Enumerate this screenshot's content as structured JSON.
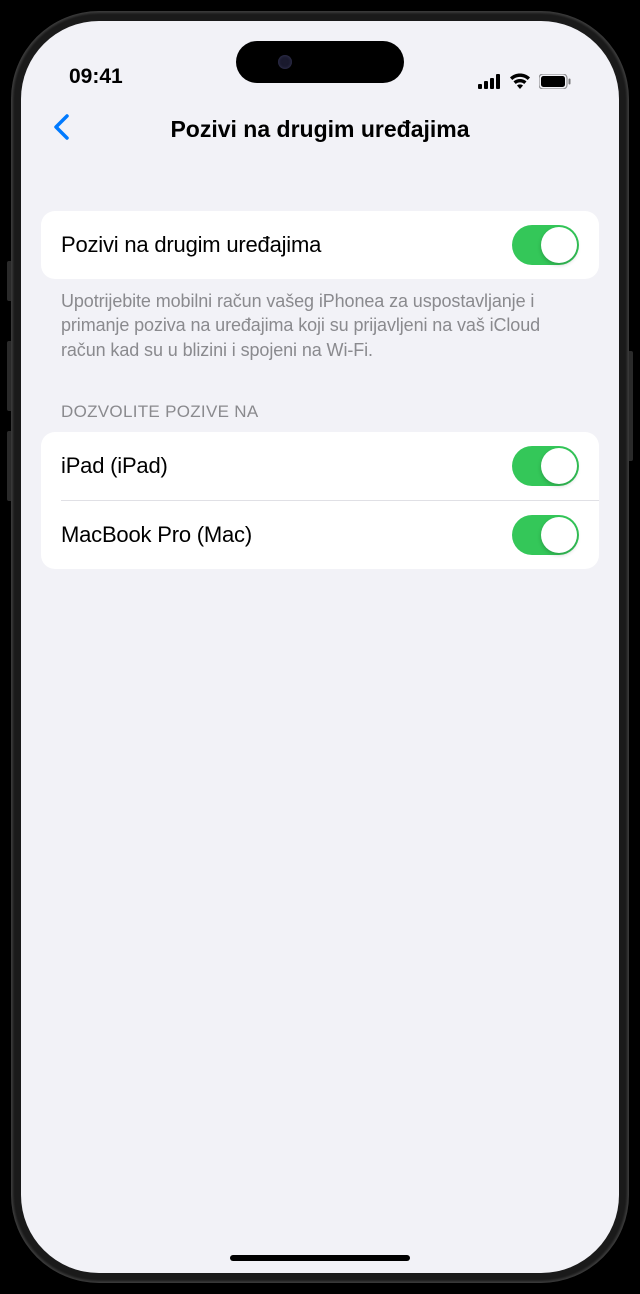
{
  "status": {
    "time": "09:41"
  },
  "nav": {
    "title": "Pozivi na drugim uređajima"
  },
  "main_toggle": {
    "label": "Pozivi na drugim uređajima",
    "on": true
  },
  "description": "Upotrijebite mobilni račun vašeg iPhonea za uspostavljanje i primanje poziva na uređajima koji su prijavljeni na vaš iCloud račun kad su u blizini i spojeni na Wi-Fi.",
  "section_header": "DOZVOLITE POZIVE NA",
  "devices": [
    {
      "label": "iPad (iPad)",
      "on": true
    },
    {
      "label": "MacBook Pro (Mac)",
      "on": true
    }
  ]
}
